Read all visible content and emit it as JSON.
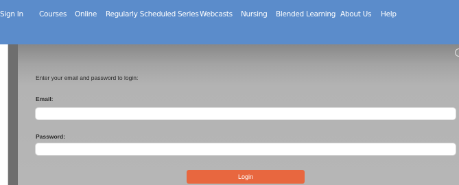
{
  "nav": {
    "items": [
      {
        "label": "Sign In"
      },
      {
        "label": "Courses"
      },
      {
        "label": "Online"
      },
      {
        "label": "Regularly Scheduled Series"
      },
      {
        "label": "Webcasts"
      },
      {
        "label": "Nursing"
      },
      {
        "label": "Blended Learning"
      },
      {
        "label": "About Us"
      },
      {
        "label": "Help"
      }
    ]
  },
  "login": {
    "intro": "Enter your email and password to login:",
    "email_label": "Email:",
    "email_value": "",
    "password_label": "Password:",
    "password_value": "",
    "button_label": "Login"
  },
  "colors": {
    "topbar": "#5b8ccb",
    "panel": "#b3b3b3",
    "login_button": "#e8673f"
  }
}
